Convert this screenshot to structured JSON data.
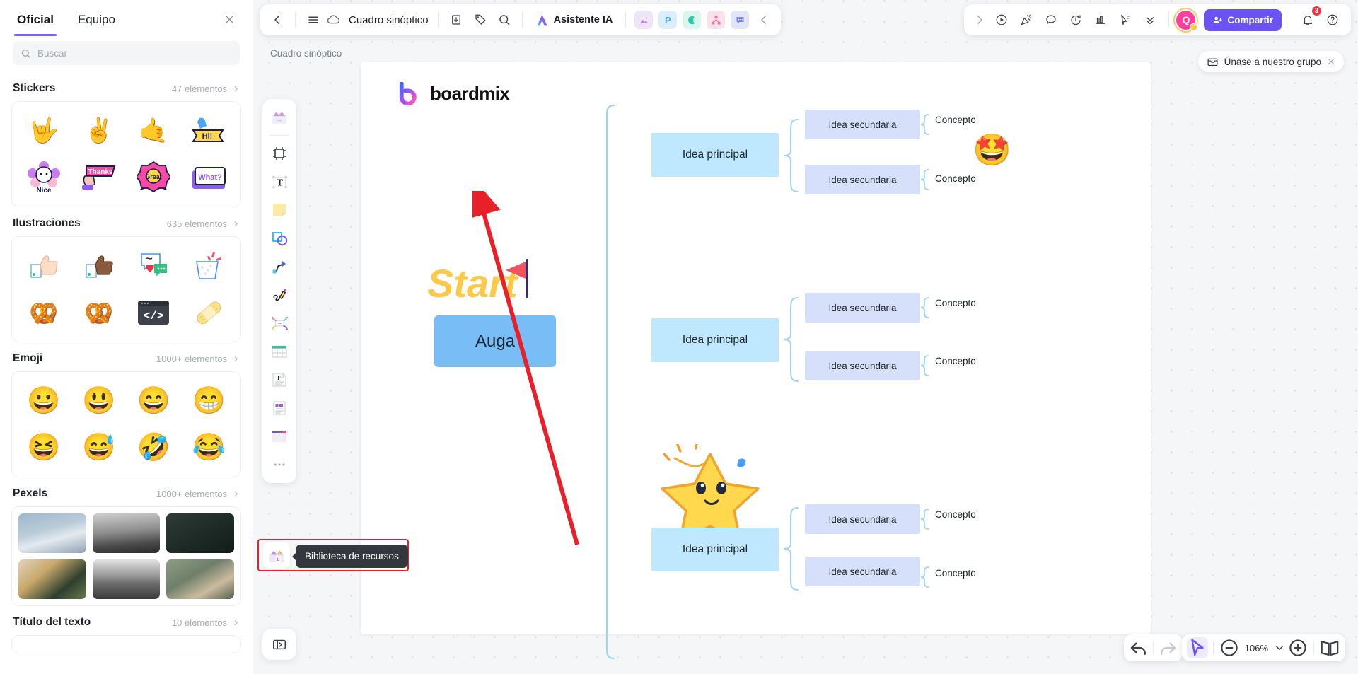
{
  "resource_panel": {
    "tabs": [
      {
        "label": "Oficial",
        "active": true
      },
      {
        "label": "Equipo",
        "active": false
      }
    ],
    "close_icon": "close-icon",
    "search": {
      "placeholder": "Buscar",
      "value": "",
      "icon": "search-icon"
    },
    "sections": [
      {
        "title": "Stickers",
        "count": "47 elementos",
        "items": [
          "🤟",
          "✌️",
          "🤙",
          "👋 Hi!",
          "🌸 Nice",
          "🚩 Thanks",
          "🏅 Great",
          "❓ What?"
        ]
      },
      {
        "title": "Ilustraciones",
        "count": "635 elementos",
        "items": [
          "👍",
          "👍🏿",
          "💬",
          "🎉",
          "🥨",
          "🥨",
          "👨‍💻",
          "🩹"
        ]
      },
      {
        "title": "Emoji",
        "count": "1000+ elementos",
        "items": [
          "😀",
          "😃",
          "😄",
          "😁",
          "😆",
          "😅",
          "🤣",
          "😂"
        ]
      },
      {
        "title": "Pexels",
        "count": "1000+ elementos",
        "items": []
      },
      {
        "title": "Título del texto",
        "count": "10 elementos",
        "items": []
      }
    ]
  },
  "toolbar": {
    "back_icon": "chevron-left-icon",
    "menu_icon": "hamburger-menu-icon",
    "cloud_icon": "cloud-saved-icon",
    "doc_title": "Cuadro sinóptico",
    "export_icon": "download-icon",
    "tag_icon": "tag-icon",
    "search_icon": "search-icon",
    "ai_label": "Asistente IA",
    "ai_icon": "ai-sparkle-icon",
    "app_icons": [
      "image-icon",
      "presentation-icon",
      "shape-icon",
      "mindmap-icon",
      "comment-icon"
    ],
    "collapse_icon": "chevron-left-icon"
  },
  "toolbar_right": {
    "expand_icon": "chevron-right-icon",
    "icons": [
      "present-play-icon",
      "celebrate-icon",
      "comment-bubble-icon",
      "timer-icon",
      "chart-icon",
      "pointer-cursor-icon",
      "chevrons-down-icon"
    ],
    "avatar_initial": "Q",
    "share_label": "Compartir",
    "share_icon": "user-add-icon",
    "notification_icon": "bell-icon",
    "notification_count": "3",
    "help_icon": "help-circle-icon",
    "share_color": "#6a52f5"
  },
  "breadcrumb": "Cuadro sinóptico",
  "join_pill": {
    "label": "Únase a nuestro grupo",
    "icon": "mail-icon",
    "close_icon": "close-icon"
  },
  "dock": {
    "items": [
      "sticker-pack-icon",
      "frame-icon",
      "text-icon",
      "sticky-note-icon",
      "shapes-icon",
      "connector-line-icon",
      "pen-draw-icon",
      "mindmap-node-icon",
      "table-icon",
      "text-card-icon",
      "document-card-icon",
      "kanban-icon",
      "more-options-icon"
    ],
    "resource_library": {
      "label": "Biblioteca de recursos",
      "icon": "resource-library-icon"
    },
    "bottom_icon": "expand-panel-icon"
  },
  "board": {
    "logo_text": "boardmix",
    "start_text": "Start",
    "auga_text": "Auga",
    "branches": [
      {
        "main": "Idea principal",
        "children": [
          {
            "secondary": "Idea secundaria",
            "concept": "Concepto"
          },
          {
            "secondary": "Idea secundaria",
            "concept": "Concepto"
          }
        ]
      },
      {
        "main": "Idea principal",
        "children": [
          {
            "secondary": "Idea secundaria",
            "concept": "Concepto"
          },
          {
            "secondary": "Idea secundaria",
            "concept": "Concepto"
          }
        ]
      },
      {
        "main": "Idea principal",
        "children": [
          {
            "secondary": "Idea secundaria",
            "concept": "Concepto"
          },
          {
            "secondary": "Idea secundaria",
            "concept": "Concepto"
          }
        ]
      }
    ],
    "star_emoji": "🤩",
    "node_colors": {
      "main": "#bfe8ff",
      "secondary": "#d6e0fb",
      "auga": "#78bdf6",
      "brace": "#9fd4f2"
    }
  },
  "bottom_controls": {
    "undo_icon": "undo-icon",
    "redo_icon": "redo-icon",
    "select_icon": "pointer-select-icon",
    "zoom_out_icon": "zoom-out-icon",
    "zoom_level": "106%",
    "zoom_dropdown_icon": "chevron-down-icon",
    "zoom_in_icon": "zoom-in-icon",
    "presentation_icon": "book-spread-icon"
  }
}
